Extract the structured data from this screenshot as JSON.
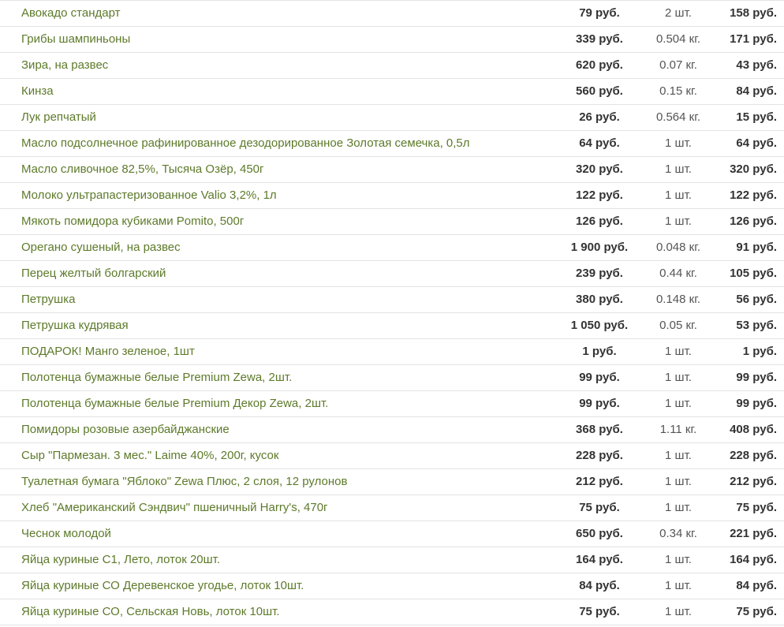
{
  "order": {
    "rows": [
      {
        "name": "Авокадо стандарт",
        "price": "79 руб.",
        "qty": "2 шт.",
        "total": "158 руб."
      },
      {
        "name": "Грибы шампиньоны",
        "price": "339 руб.",
        "qty": "0.504 кг.",
        "total": "171 руб."
      },
      {
        "name": "Зира, на развес",
        "price": "620 руб.",
        "qty": "0.07 кг.",
        "total": "43 руб."
      },
      {
        "name": "Кинза",
        "price": "560 руб.",
        "qty": "0.15 кг.",
        "total": "84 руб."
      },
      {
        "name": "Лук репчатый",
        "price": "26 руб.",
        "qty": "0.564 кг.",
        "total": "15 руб."
      },
      {
        "name": "Масло подсолнечное рафинированное дезодорированное Золотая семечка, 0,5л",
        "price": "64 руб.",
        "qty": "1 шт.",
        "total": "64 руб."
      },
      {
        "name": "Масло сливочное 82,5%, Тысяча Озёр, 450г",
        "price": "320 руб.",
        "qty": "1 шт.",
        "total": "320 руб."
      },
      {
        "name": "Молоко ультрапастеризованное Valio 3,2%, 1л",
        "price": "122 руб.",
        "qty": "1 шт.",
        "total": "122 руб."
      },
      {
        "name": "Мякоть помидора кубиками Pomito, 500г",
        "price": "126 руб.",
        "qty": "1 шт.",
        "total": "126 руб."
      },
      {
        "name": "Орегано сушеный, на развес",
        "price": "1 900 руб.",
        "qty": "0.048 кг.",
        "total": "91 руб."
      },
      {
        "name": "Перец желтый болгарский",
        "price": "239 руб.",
        "qty": "0.44 кг.",
        "total": "105 руб."
      },
      {
        "name": "Петрушка",
        "price": "380 руб.",
        "qty": "0.148 кг.",
        "total": "56 руб."
      },
      {
        "name": "Петрушка кудрявая",
        "price": "1 050 руб.",
        "qty": "0.05 кг.",
        "total": "53 руб."
      },
      {
        "name": "ПОДАРОК! Манго зеленое, 1шт",
        "price": "1 руб.",
        "qty": "1 шт.",
        "total": "1 руб."
      },
      {
        "name": "Полотенца бумажные белые Premium Zewa, 2шт.",
        "price": "99 руб.",
        "qty": "1 шт.",
        "total": "99 руб."
      },
      {
        "name": "Полотенца бумажные белые Premium Декор Zewa, 2шт.",
        "price": "99 руб.",
        "qty": "1 шт.",
        "total": "99 руб."
      },
      {
        "name": "Помидоры розовые азербайджанские",
        "price": "368 руб.",
        "qty": "1.11 кг.",
        "total": "408 руб."
      },
      {
        "name": "Сыр \"Пармезан. 3 мес.\" Laime 40%, 200г, кусок",
        "price": "228 руб.",
        "qty": "1 шт.",
        "total": "228 руб."
      },
      {
        "name": "Туалетная бумага \"Яблоко\" Zewa Плюс, 2 слоя, 12 рулонов",
        "price": "212 руб.",
        "qty": "1 шт.",
        "total": "212 руб."
      },
      {
        "name": "Хлеб \"Американский Сэндвич\" пшеничный Harry's, 470г",
        "price": "75 руб.",
        "qty": "1 шт.",
        "total": "75 руб."
      },
      {
        "name": "Чеснок молодой",
        "price": "650 руб.",
        "qty": "0.34 кг.",
        "total": "221 руб."
      },
      {
        "name": "Яйца куриные С1, Лето, лоток 20шт.",
        "price": "164 руб.",
        "qty": "1 шт.",
        "total": "164 руб."
      },
      {
        "name": "Яйца куриные СО Деревенское угодье, лоток 10шт.",
        "price": "84 руб.",
        "qty": "1 шт.",
        "total": "84 руб."
      },
      {
        "name": "Яйца куриные СО, Сельская Новь, лоток 10шт.",
        "price": "75 руб.",
        "qty": "1 шт.",
        "total": "75 руб."
      }
    ]
  },
  "colors": {
    "product_link": "#5d7a2a",
    "bold_text": "#333333",
    "divider": "#e3e3e3"
  }
}
